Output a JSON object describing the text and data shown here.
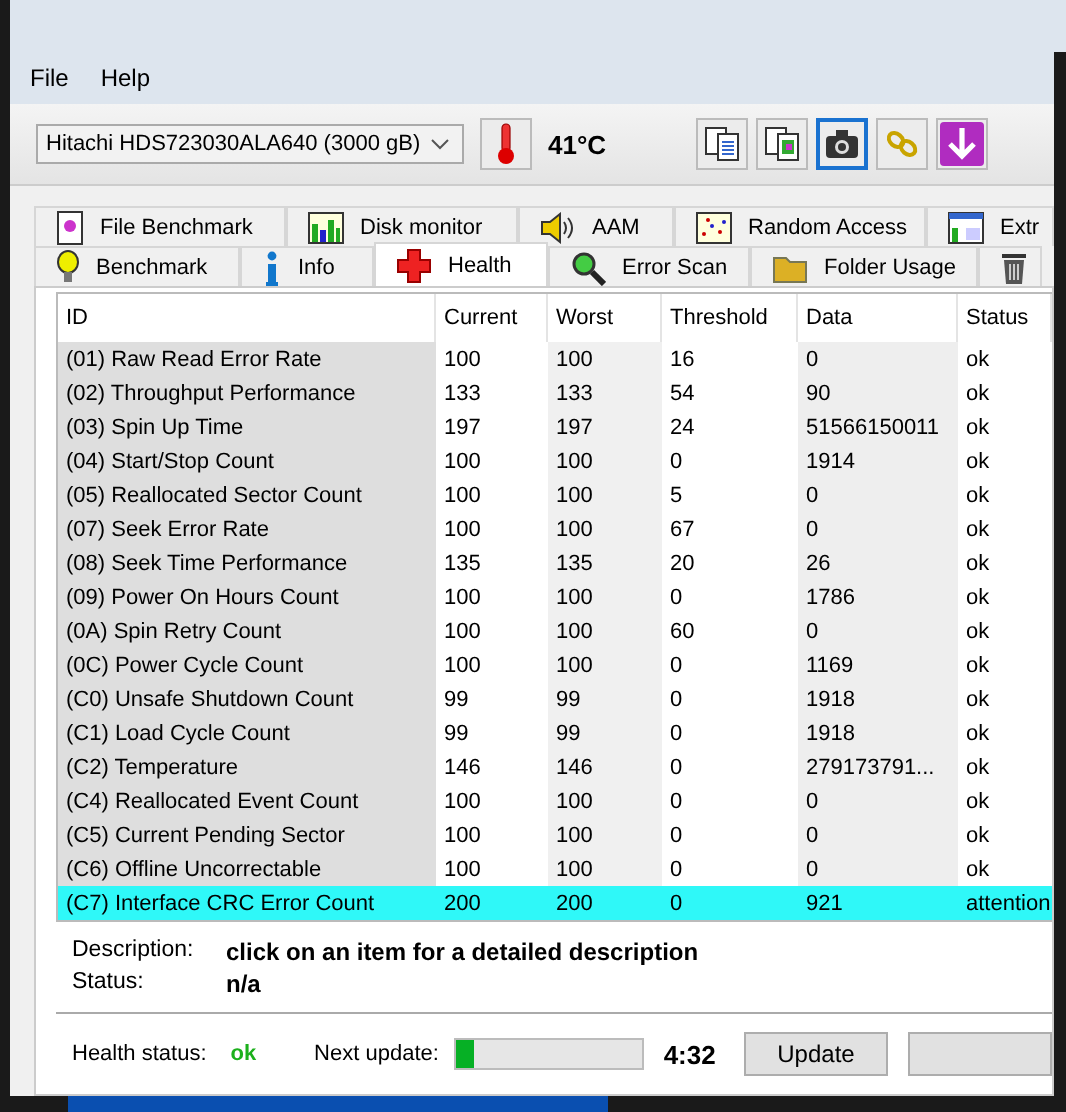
{
  "menu": [
    "File",
    "Help"
  ],
  "drive": {
    "value": "Hitachi HDS723030ALA640 (3000 gB)"
  },
  "temperature": "41°C",
  "toolbar": [
    {
      "kind": "copy",
      "selected": false
    },
    {
      "kind": "copy-image",
      "selected": false
    },
    {
      "kind": "camera",
      "selected": true
    },
    {
      "kind": "chain",
      "selected": false
    },
    {
      "kind": "download",
      "selected": false
    }
  ],
  "tabs_back": [
    {
      "label": "File Benchmark",
      "kind": "file"
    },
    {
      "label": "Disk monitor",
      "kind": "monitor"
    },
    {
      "label": "AAM",
      "kind": "speaker"
    },
    {
      "label": "Random Access",
      "kind": "scatter"
    },
    {
      "label": "Extr",
      "kind": "window"
    }
  ],
  "tabs": [
    {
      "label": "Benchmark",
      "kind": "bulb",
      "selected": false
    },
    {
      "label": "Info",
      "kind": "info",
      "selected": false
    },
    {
      "label": "Health",
      "kind": "cross",
      "selected": true
    },
    {
      "label": "Error Scan",
      "kind": "magnifier",
      "selected": false
    },
    {
      "label": "Folder Usage",
      "kind": "folder",
      "selected": false
    },
    {
      "kind": "trash",
      "selected": false
    }
  ],
  "table": {
    "columns": [
      "ID",
      "Current",
      "Worst",
      "Threshold",
      "Data",
      "Status"
    ],
    "rows": [
      {
        "cells": [
          "(01) Raw Read Error Rate",
          "100",
          "100",
          "16",
          "0",
          "ok"
        ],
        "selected": false
      },
      {
        "cells": [
          "(02) Throughput Performance",
          "133",
          "133",
          "54",
          "90",
          "ok"
        ],
        "selected": false
      },
      {
        "cells": [
          "(03) Spin Up Time",
          "197",
          "197",
          "24",
          "51566150011",
          "ok"
        ],
        "selected": false
      },
      {
        "cells": [
          "(04) Start/Stop Count",
          "100",
          "100",
          "0",
          "1914",
          "ok"
        ],
        "selected": false
      },
      {
        "cells": [
          "(05) Reallocated Sector Count",
          "100",
          "100",
          "5",
          "0",
          "ok"
        ],
        "selected": false
      },
      {
        "cells": [
          "(07) Seek Error Rate",
          "100",
          "100",
          "67",
          "0",
          "ok"
        ],
        "selected": false
      },
      {
        "cells": [
          "(08) Seek Time Performance",
          "135",
          "135",
          "20",
          "26",
          "ok"
        ],
        "selected": false
      },
      {
        "cells": [
          "(09) Power On Hours Count",
          "100",
          "100",
          "0",
          "1786",
          "ok"
        ],
        "selected": false
      },
      {
        "cells": [
          "(0A) Spin Retry Count",
          "100",
          "100",
          "60",
          "0",
          "ok"
        ],
        "selected": false
      },
      {
        "cells": [
          "(0C) Power Cycle Count",
          "100",
          "100",
          "0",
          "1169",
          "ok"
        ],
        "selected": false
      },
      {
        "cells": [
          "(C0) Unsafe Shutdown Count",
          "99",
          "99",
          "0",
          "1918",
          "ok"
        ],
        "selected": false
      },
      {
        "cells": [
          "(C1) Load Cycle Count",
          "99",
          "99",
          "0",
          "1918",
          "ok"
        ],
        "selected": false
      },
      {
        "cells": [
          "(C2) Temperature",
          "146",
          "146",
          "0",
          "279173791...",
          "ok"
        ],
        "selected": false
      },
      {
        "cells": [
          "(C4) Reallocated Event Count",
          "100",
          "100",
          "0",
          "0",
          "ok"
        ],
        "selected": false
      },
      {
        "cells": [
          "(C5) Current Pending Sector",
          "100",
          "100",
          "0",
          "0",
          "ok"
        ],
        "selected": false
      },
      {
        "cells": [
          "(C6) Offline Uncorrectable",
          "100",
          "100",
          "0",
          "0",
          "ok"
        ],
        "selected": false
      },
      {
        "cells": [
          "(C7) Interface CRC Error Count",
          "200",
          "200",
          "0",
          "921",
          "attention"
        ],
        "selected": true
      }
    ]
  },
  "details": [
    {
      "label": "Description:",
      "value": "click on an item for a detailed description"
    },
    {
      "label": "Status:",
      "value": "n/a"
    }
  ],
  "status_bar": {
    "health_label": "Health status:",
    "health_value": "ok",
    "next_update_label": "Next update:",
    "level": 0.09,
    "time": "4:32",
    "buttons": [
      {
        "label": "Update"
      },
      {
        "kind": "cut-off"
      }
    ]
  }
}
